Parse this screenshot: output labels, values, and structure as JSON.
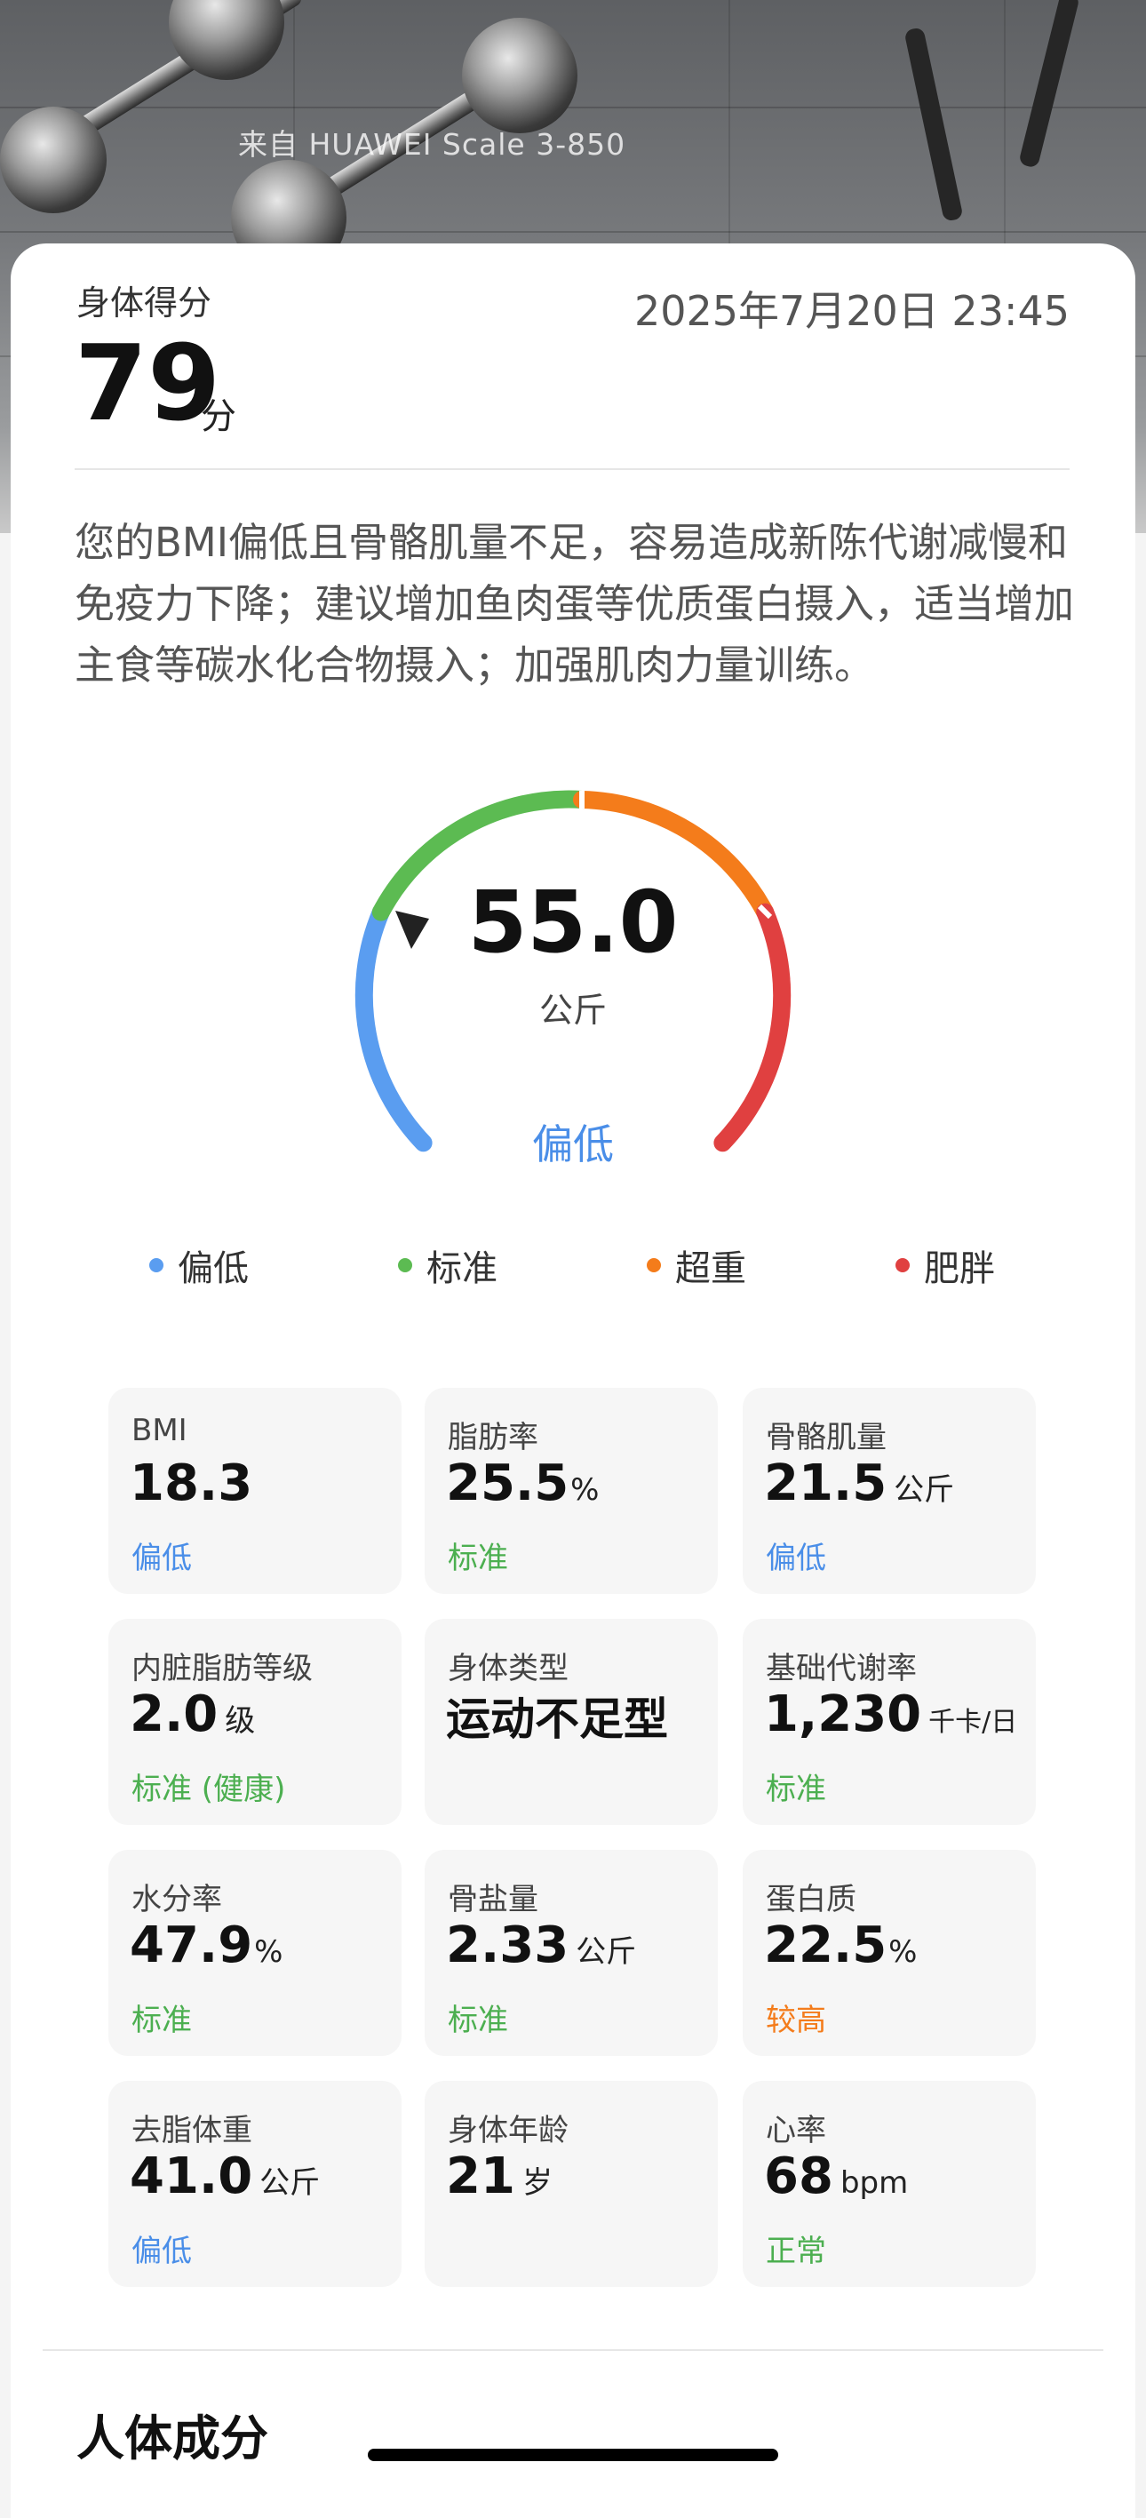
{
  "header": {
    "source": "来自 HUAWEI Scale 3-850"
  },
  "summary": {
    "label": "身体得分",
    "datetime": "2025年7月20日 23:45",
    "score": "79",
    "score_unit": "分",
    "advice": "您的BMI偏低且骨骼肌量不足，容易造成新陈代谢减慢和免疫力下降；建议增加鱼肉蛋等优质蛋白摄入，适当增加主食等碳水化合物摄入；加强肌肉力量训练。"
  },
  "gauge": {
    "value": "55.0",
    "unit": "公斤",
    "status": "偏低",
    "status_color": "#4a8ee8",
    "segment_colors": [
      "#5a9df0",
      "#5cbb52",
      "#f47c1b",
      "#e04040"
    ]
  },
  "legend": [
    {
      "label": "偏低",
      "color": "#5a9df0"
    },
    {
      "label": "标准",
      "color": "#5cbb52"
    },
    {
      "label": "超重",
      "color": "#f47c1b"
    },
    {
      "label": "肥胖",
      "color": "#e04040"
    }
  ],
  "metrics": [
    {
      "label": "BMI",
      "value": "18.3",
      "unit": "",
      "status": "偏低",
      "status_color": "#4a8ee8"
    },
    {
      "label": "脂肪率",
      "value": "25.5",
      "unit": "%",
      "status": "标准",
      "status_color": "#4caf50"
    },
    {
      "label": "骨骼肌量",
      "value": "21.5",
      "unit": "公斤",
      "status": "偏低",
      "status_color": "#4a8ee8"
    },
    {
      "label": "内脏脂肪等级",
      "value": "2.0",
      "unit": "级",
      "status": "标准 (健康)",
      "status_color": "#4caf50"
    },
    {
      "label": "身体类型",
      "value": "运动不足型",
      "unit": "",
      "status": "",
      "status_color": "#4caf50"
    },
    {
      "label": "基础代谢率",
      "value": "1,230",
      "unit": "千卡/日",
      "status": "标准",
      "status_color": "#4caf50"
    },
    {
      "label": "水分率",
      "value": "47.9",
      "unit": "%",
      "status": "标准",
      "status_color": "#4caf50"
    },
    {
      "label": "骨盐量",
      "value": "2.33",
      "unit": "公斤",
      "status": "标准",
      "status_color": "#4caf50"
    },
    {
      "label": "蛋白质",
      "value": "22.5",
      "unit": "%",
      "status": "较高",
      "status_color": "#f47c1b"
    },
    {
      "label": "去脂体重",
      "value": "41.0",
      "unit": "公斤",
      "status": "偏低",
      "status_color": "#4a8ee8"
    },
    {
      "label": "身体年龄",
      "value": "21",
      "unit": "岁",
      "status": "",
      "status_color": "#4caf50"
    },
    {
      "label": "心率",
      "value": "68",
      "unit": "bpm",
      "status": "正常",
      "status_color": "#4caf50"
    }
  ],
  "section": {
    "title": "人体成分"
  }
}
